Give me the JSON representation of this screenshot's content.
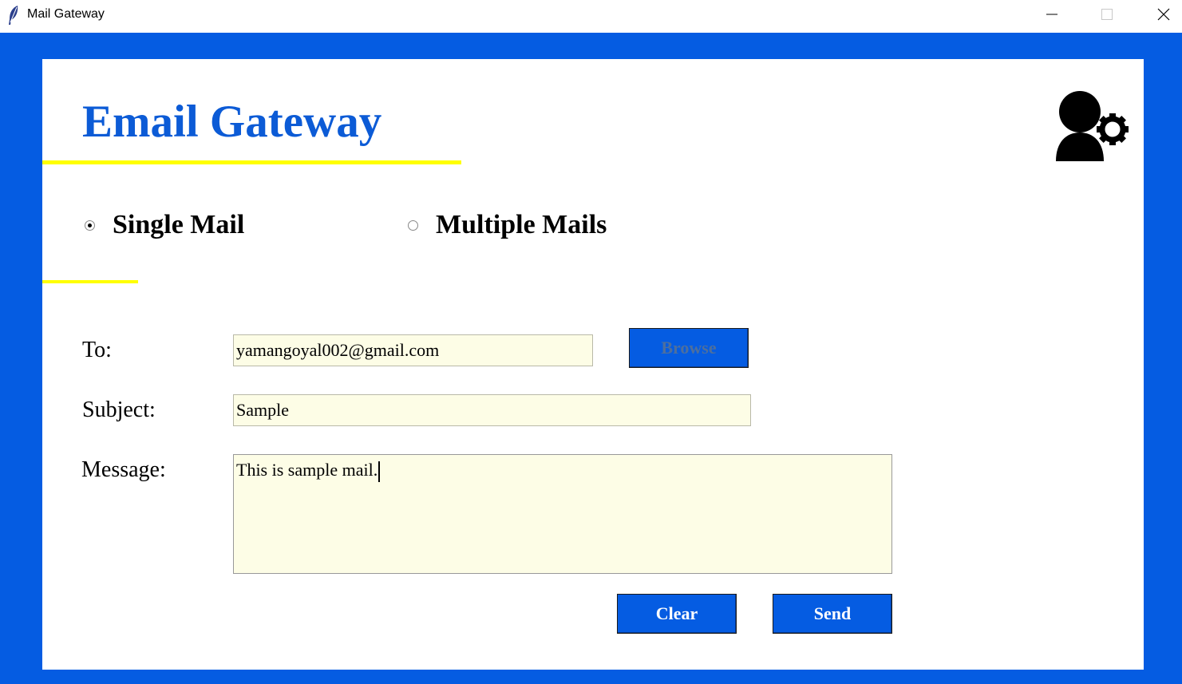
{
  "window": {
    "title": "Mail Gateway",
    "icon": "feather-icon",
    "controls": [
      "minimize-icon",
      "maximize-icon",
      "close-icon"
    ]
  },
  "colors": {
    "frame": "#055ce2",
    "heading": "#0c5bd6",
    "accent_line": "#ffff00",
    "input_bg": "#fdfde6",
    "button_bg": "#055ce2"
  },
  "header": {
    "title": "Email Gateway",
    "icon": "user-settings-icon"
  },
  "mode": {
    "options": [
      {
        "label": "Single Mail",
        "selected": true
      },
      {
        "label": "Multiple Mails",
        "selected": false
      }
    ]
  },
  "form": {
    "to_label": "To:",
    "to_value": "yamangoyal002@gmail.com",
    "browse_label": "Browse",
    "subject_label": "Subject:",
    "subject_value": "Sample",
    "message_label": "Message:",
    "message_value": "This is sample mail."
  },
  "actions": {
    "clear_label": "Clear",
    "send_label": "Send"
  }
}
